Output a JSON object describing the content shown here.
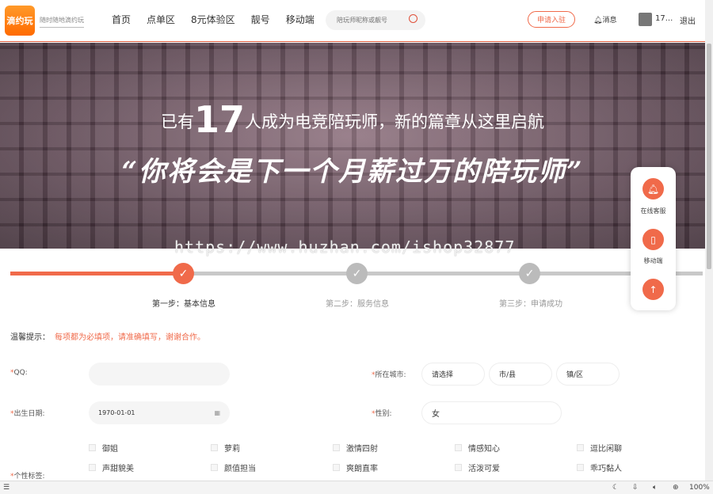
{
  "header": {
    "logo": "滴约玩",
    "slogan": "随时随地滴约玩",
    "nav": [
      "首页",
      "点单区",
      "8元体验区",
      "靓号",
      "移动端"
    ],
    "search_placeholder": "陪玩师昵称或靓号",
    "apply": "申请入驻",
    "message": "消息",
    "username": "17...",
    "logout": "退出"
  },
  "banner": {
    "prefix": "已有",
    "count": "17",
    "suffix": "人成为电竞陪玩师，新的篇章从这里启航",
    "slogan": "“你将会是下一个月薪过万的陪玩师”"
  },
  "watermark": "https://www.huzhan.com/ishop32877",
  "steps": [
    {
      "label": "第一步：基本信息",
      "done": true,
      "active": true
    },
    {
      "label": "第二步：服务信息",
      "done": true,
      "active": false
    },
    {
      "label": "第三步：申请成功",
      "done": true,
      "active": false
    }
  ],
  "progress_percent": 25,
  "tip": {
    "label": "温馨提示：",
    "text": "每项都为必填项，请准确填写，谢谢合作。"
  },
  "form": {
    "qq_label": "QQ:",
    "qq_value": "",
    "city_label": "所在城市:",
    "province": "请选择",
    "city": "市/县",
    "district": "镇/区",
    "birth_label": "出生日期:",
    "birth_value": "1970-01-01",
    "gender_label": "性别:",
    "gender_value": "女",
    "tags_label": "个性标签:",
    "required_mark": "*",
    "tags": [
      "御姐",
      "萝莉",
      "激情四射",
      "情感知心",
      "逗比闲聊",
      "声甜貌美",
      "颜值担当",
      "爽朗直率",
      "活泼可爱",
      "乖巧黏人"
    ]
  },
  "float": {
    "service": "在线客服",
    "mobile": "移动端"
  },
  "status": {
    "zoom": "100%"
  },
  "colors": {
    "accent": "#f06a4a"
  }
}
